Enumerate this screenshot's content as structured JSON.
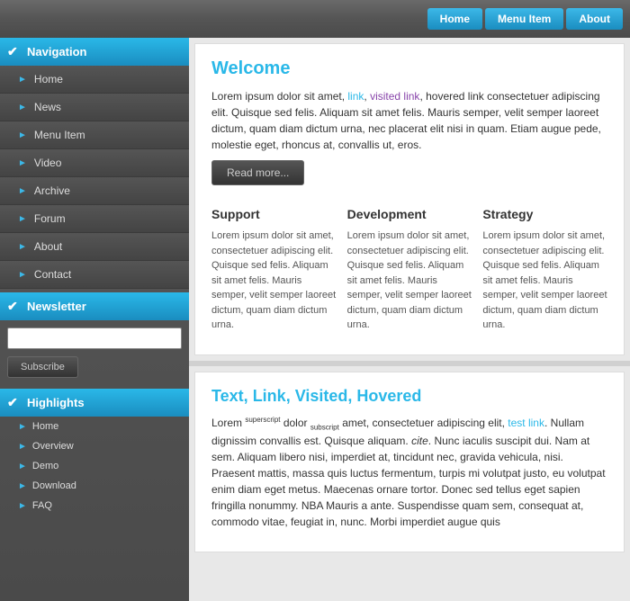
{
  "topnav": {
    "buttons": [
      {
        "label": "Home",
        "id": "home"
      },
      {
        "label": "Menu Item",
        "id": "menu-item"
      },
      {
        "label": "About",
        "id": "about"
      }
    ]
  },
  "sidebar": {
    "navigation_header": "Navigation",
    "nav_items": [
      {
        "label": "Home",
        "id": "nav-home"
      },
      {
        "label": "News",
        "id": "nav-news"
      },
      {
        "label": "Menu Item",
        "id": "nav-menu-item"
      },
      {
        "label": "Video",
        "id": "nav-video"
      },
      {
        "label": "Archive",
        "id": "nav-archive"
      },
      {
        "label": "Forum",
        "id": "nav-forum"
      },
      {
        "label": "About",
        "id": "nav-about"
      },
      {
        "label": "Contact",
        "id": "nav-contact"
      }
    ],
    "newsletter_header": "Newsletter",
    "newsletter_placeholder": "",
    "subscribe_label": "Subscribe",
    "highlights_header": "Highlights",
    "highlights_items": [
      {
        "label": "Home"
      },
      {
        "label": "Overview"
      },
      {
        "label": "Demo"
      },
      {
        "label": "Download"
      },
      {
        "label": "FAQ"
      }
    ]
  },
  "main": {
    "welcome_title": "Welcome",
    "welcome_text": "Lorem ipsum dolor sit amet, link, visited link, hovered link consectetuer adipiscing elit. Quisque sed felis. Aliquam sit amet felis. Mauris semper, velit semper laoreet dictum, quam diam dictum urna, nec placerat elit nisi in quam. Etiam augue pede, molestie eget, rhoncus at, convallis ut, eros.",
    "read_more_label": "Read more...",
    "col1_title": "Support",
    "col1_text": "Lorem ipsum dolor sit amet, consectetuer adipiscing elit. Quisque sed felis. Aliquam sit amet felis. Mauris semper, velit semper laoreet dictum, quam diam dictum urna.",
    "col2_title": "Development",
    "col2_text": "Lorem ipsum dolor sit amet, consectetuer adipiscing elit. Quisque sed felis. Aliquam sit amet felis. Mauris semper, velit semper laoreet dictum, quam diam dictum urna.",
    "col3_title": "Strategy",
    "col3_text": "Lorem ipsum dolor sit amet, consectetuer adipiscing elit. Quisque sed felis. Aliquam sit amet felis. Mauris semper, velit semper laoreet dictum, quam diam dictum urna.",
    "text_link_title_prefix": "Text, ",
    "text_link_title_link": "Link",
    "text_link_title_middle": ", Visited, Hovered",
    "text_link_body1": "Lorem  dolor  amet, consectetuer adipiscing elit,  Nullam dignissim convallis est. Quisque aliquam.  Nunc iaculis suscipit dui. Nam at sem. Aliquam libero nisi, imperdiet at, tincidunt nec, gravida vehicula, nisi. Praesent mattis, massa quis luctus fermentum, turpis mi volutpat justo, eu volutpat enim diam eget metus. Maecenas ornare tortor. Donec sed tellus eget sapien fringilla nonummy. NBA Mauris a ante. Suspendisse quam sem, consequat at, commodo vitae, feugiat in, nunc. Morbi imperdiet augue quis"
  }
}
